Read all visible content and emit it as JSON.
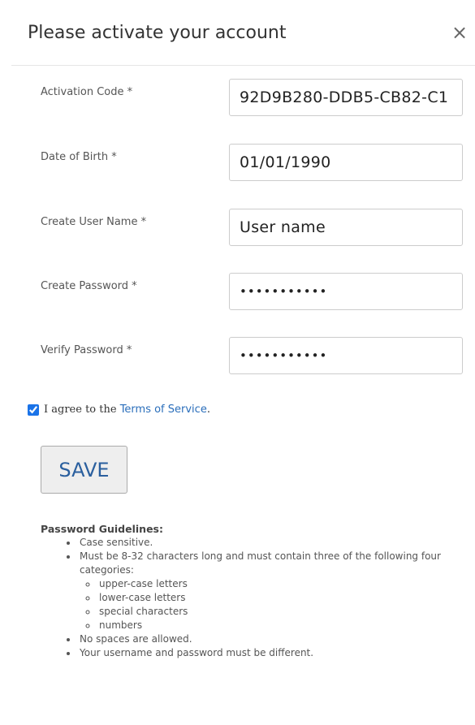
{
  "dialog": {
    "title": "Please activate your account",
    "close_label": "×"
  },
  "form": {
    "activation_code": {
      "label": "Activation Code *",
      "value": "92D9B280-DDB5-CB82-C1"
    },
    "date_of_birth": {
      "label": "Date of Birth *",
      "value": "01/01/1990"
    },
    "user_name": {
      "label": "Create User Name *",
      "value": "User name"
    },
    "password": {
      "label": "Create Password *",
      "value": "•••••••••••"
    },
    "verify_password": {
      "label": "Verify Password *",
      "value": "•••••••••••"
    }
  },
  "agreement": {
    "checked": true,
    "prefix": "I agree to the ",
    "link_text": "Terms of Service",
    "suffix": "."
  },
  "save_label": "SAVE",
  "guidelines": {
    "title": "Password Guidelines:",
    "items": [
      "Case sensitive.",
      "Must be 8-32 characters long and must contain three of the following four categories:",
      "No spaces are allowed.",
      "Your username and password must be different."
    ],
    "categories": [
      "upper-case letters",
      "lower-case letters",
      "special characters",
      "numbers"
    ]
  },
  "colors": {
    "link": "#2a6ebb",
    "save_text": "#2a5f9e",
    "checkbox": "#1a73e8"
  }
}
